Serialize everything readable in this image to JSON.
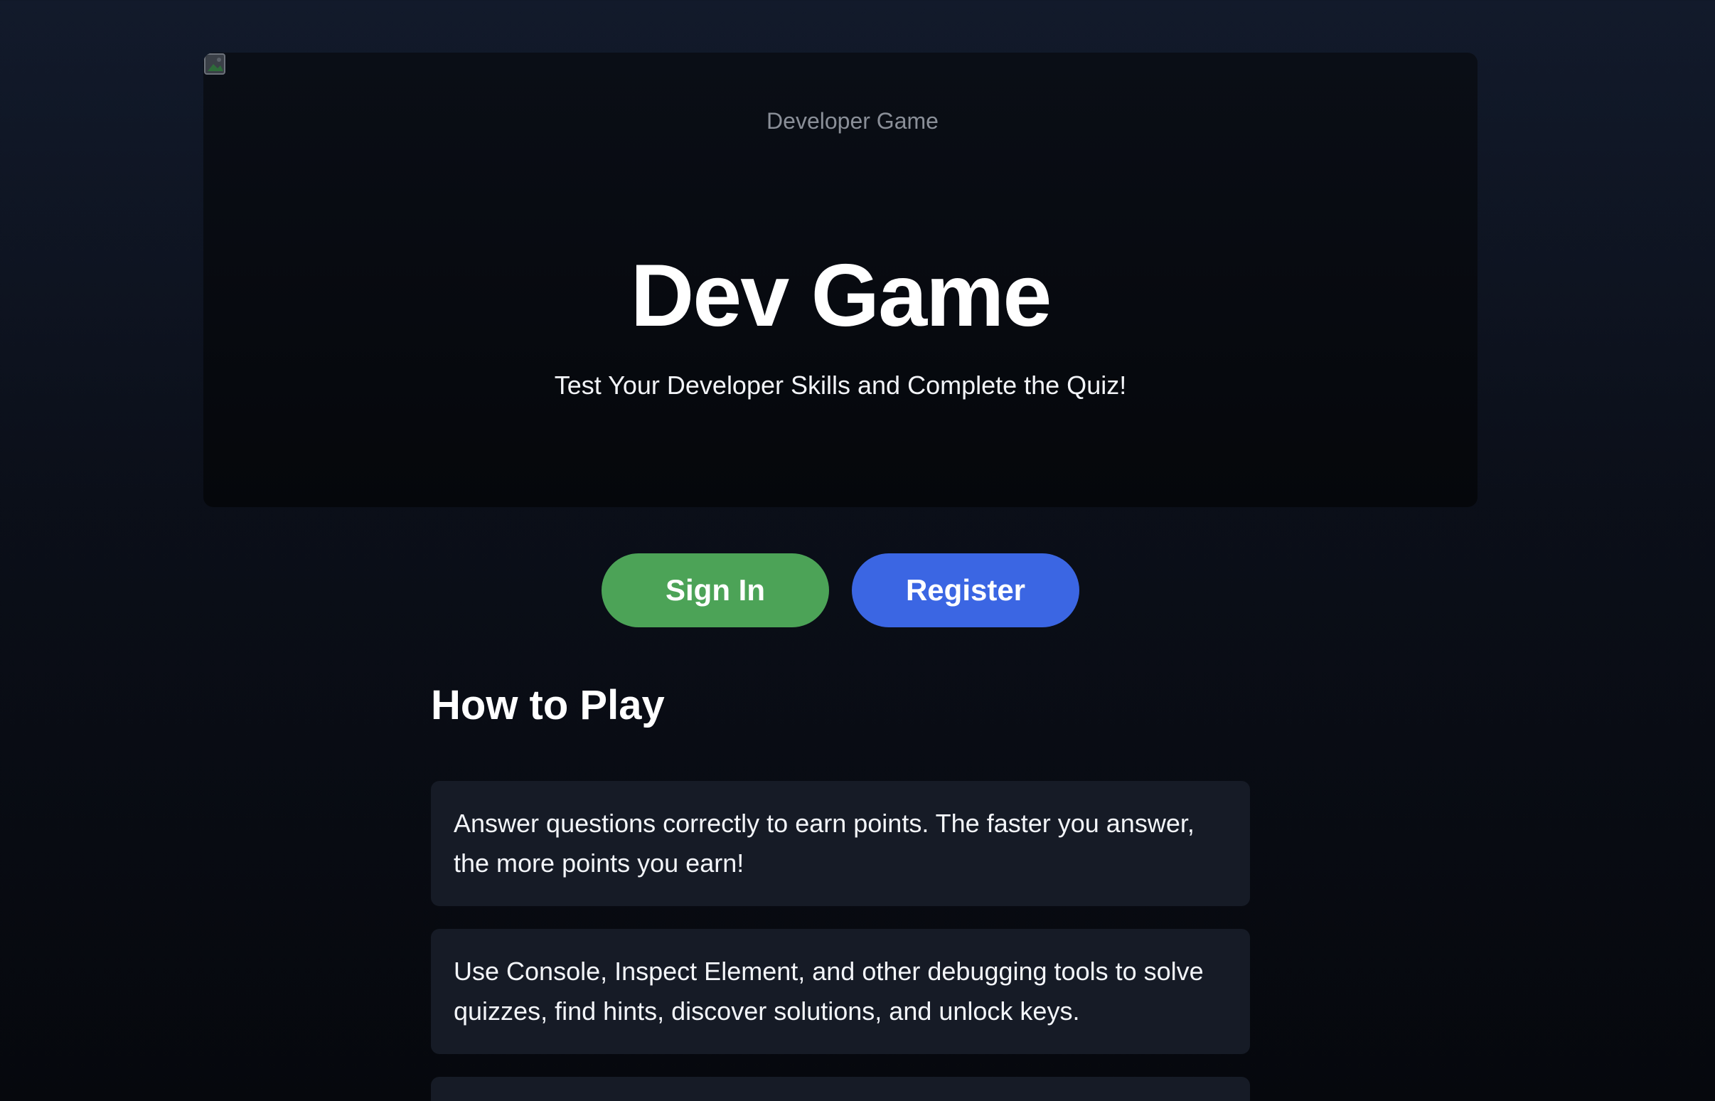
{
  "hero": {
    "image_alt": "Developer Game",
    "title": "Dev Game",
    "subtitle": "Test Your Developer Skills and Complete the Quiz!"
  },
  "actions": {
    "sign_in_label": "Sign In",
    "register_label": "Register"
  },
  "how_to_play": {
    "title": "How to Play",
    "rules": [
      "Answer questions correctly to earn points. The faster you answer, the more points you earn!",
      "Use Console, Inspect Element, and other debugging tools to solve quizzes, find hints, discover solutions, and unlock keys.",
      ""
    ]
  },
  "colors": {
    "sign_in": "#4ca357",
    "register": "#3b66e3",
    "card": "#161b26"
  }
}
